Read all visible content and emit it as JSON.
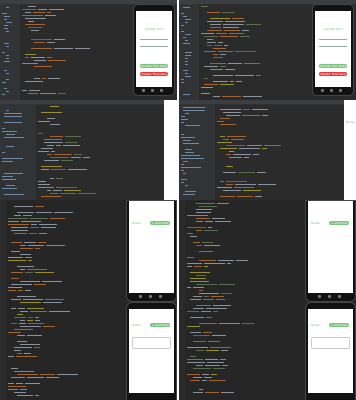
{
  "app": {
    "top_left_phone": {
      "title": "Update Form",
      "update_button": "Update This Data",
      "delete_button": "Delete This Data"
    },
    "top_right_phone": {
      "title": "Update Form",
      "update_button": "Update This Data",
      "delete_button": "Delete This Data"
    },
    "mid_right_phone": {
      "title": "Notes"
    },
    "bottom_left_phones": [
      {
        "title": "Notes",
        "add_button": "+ Add Note"
      },
      {
        "title": "Notes",
        "add_button": "+ Add Note"
      }
    ],
    "bottom_right_phones": [
      {
        "title": "Notes",
        "add_button": "+ Add Note"
      },
      {
        "title": "Notes",
        "add_button": "+ Add Note"
      }
    ]
  },
  "colors": {
    "editor_bg": "#2b2b2b",
    "accent_green": "#7bc67e",
    "danger_red": "#e53935",
    "keyword": "#cc7832",
    "string": "#6a8759",
    "identifier": "#a9b7c6",
    "annotation": "#bbb529"
  }
}
